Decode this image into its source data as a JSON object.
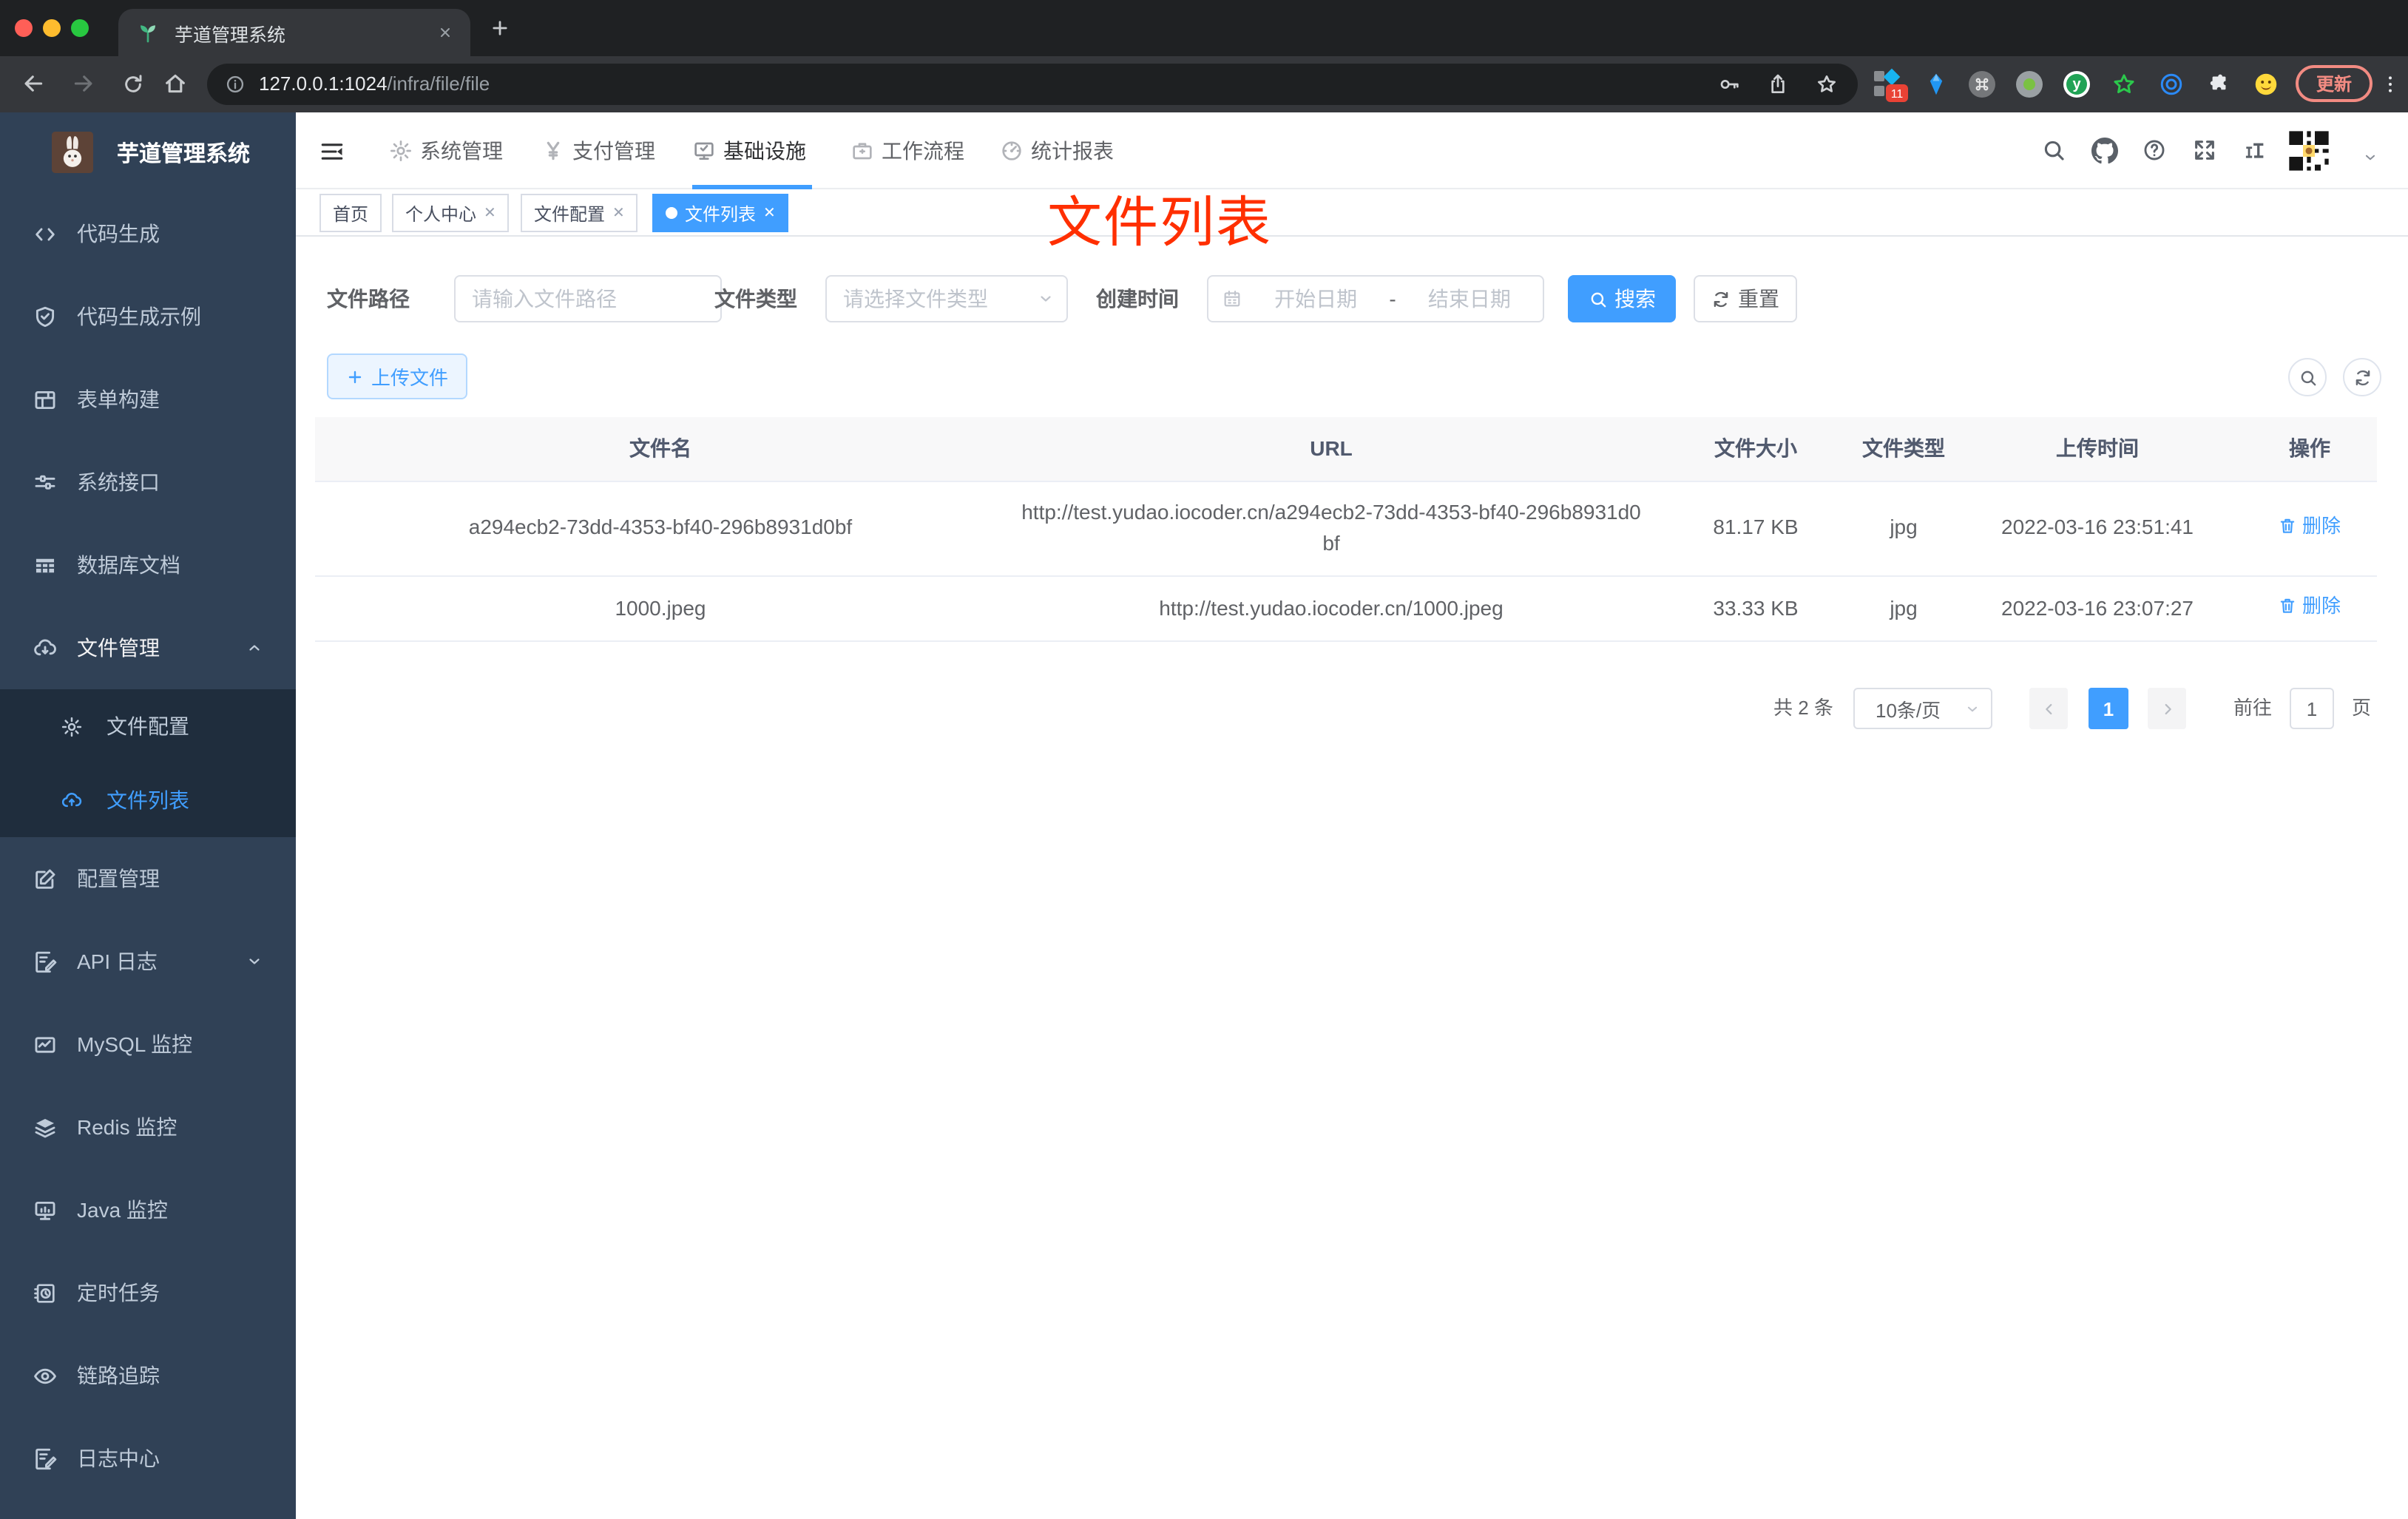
{
  "colors": {
    "accent": "#409eff",
    "annotation_red": "#ff2f00",
    "sidebar_bg": "#304156",
    "sidebar_submenu_bg": "#1f2d3d",
    "active_tab": "#409eff"
  },
  "browser": {
    "tab_title": "芋道管理系统",
    "url_host": "127.0.0.1:1024",
    "url_path": "/infra/file/file",
    "extension_badge": "11",
    "update_button": "更新"
  },
  "topnav": {
    "menus": [
      {
        "label": "系统管理"
      },
      {
        "label": "支付管理"
      },
      {
        "label": "基础设施"
      },
      {
        "label": "工作流程"
      },
      {
        "label": "统计报表"
      }
    ]
  },
  "sidebar": {
    "title": "芋道管理系统",
    "items": [
      {
        "label": "代码生成"
      },
      {
        "label": "代码生成示例"
      },
      {
        "label": "表单构建"
      },
      {
        "label": "系统接口"
      },
      {
        "label": "数据库文档"
      },
      {
        "label": "文件管理",
        "children": [
          {
            "label": "文件配置"
          },
          {
            "label": "文件列表"
          }
        ]
      },
      {
        "label": "配置管理"
      },
      {
        "label": "API 日志"
      },
      {
        "label": "MySQL 监控"
      },
      {
        "label": "Redis 监控"
      },
      {
        "label": "Java 监控"
      },
      {
        "label": "定时任务"
      },
      {
        "label": "链路追踪"
      },
      {
        "label": "日志中心"
      }
    ]
  },
  "tags": {
    "items": [
      {
        "label": "首页"
      },
      {
        "label": "个人中心"
      },
      {
        "label": "文件配置"
      },
      {
        "label": "文件列表"
      }
    ]
  },
  "annotation": {
    "text": "文件列表"
  },
  "filter": {
    "path_label": "文件路径",
    "path_placeholder": "请输入文件路径",
    "type_label": "文件类型",
    "type_placeholder": "请选择文件类型",
    "date_label": "创建时间",
    "date_start_placeholder": "开始日期",
    "date_separator": "-",
    "date_end_placeholder": "结束日期",
    "search_label": "搜索",
    "reset_label": "重置"
  },
  "toolbar": {
    "upload_label": "上传文件"
  },
  "table": {
    "columns": [
      "文件名",
      "URL",
      "文件大小",
      "文件类型",
      "上传时间",
      "操作"
    ],
    "rows": [
      {
        "name": "a294ecb2-73dd-4353-bf40-296b8931d0bf",
        "url": "http://test.yudao.iocoder.cn/a294ecb2-73dd-4353-bf40-296b8931d0bf",
        "size": "81.17 KB",
        "type": "jpg",
        "time": "2022-03-16 23:51:41",
        "action": "删除"
      },
      {
        "name": "1000.jpeg",
        "url": "http://test.yudao.iocoder.cn/1000.jpeg",
        "size": "33.33 KB",
        "type": "jpg",
        "time": "2022-03-16 23:07:27",
        "action": "删除"
      }
    ]
  },
  "pagination": {
    "total": "共 2 条",
    "page_size": "10条/页",
    "page": "1",
    "goto_label": "前往",
    "goto_value": "1",
    "unit": "页"
  }
}
